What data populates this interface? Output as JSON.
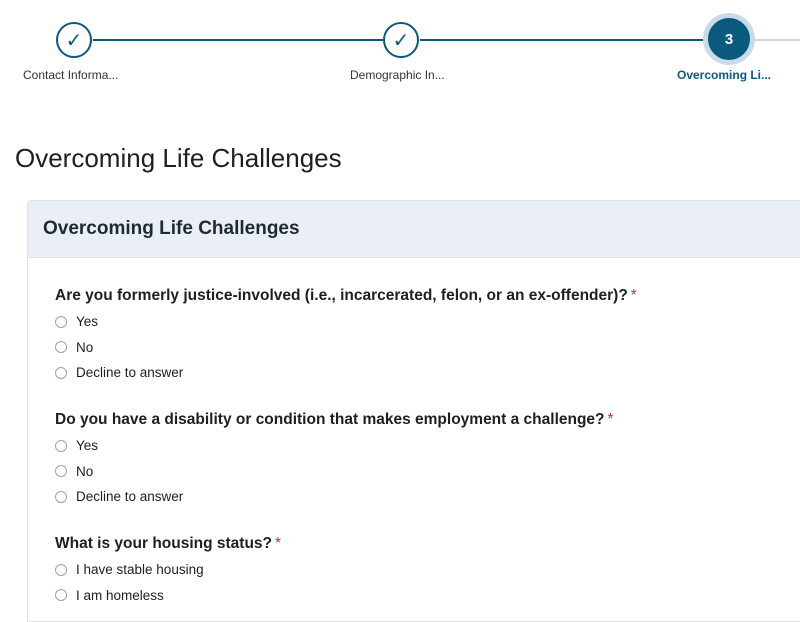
{
  "stepper": {
    "steps": [
      {
        "label": "Contact Informa...",
        "state": "done",
        "icon": "check-icon"
      },
      {
        "label": "Demographic In...",
        "state": "done",
        "icon": "check-icon"
      },
      {
        "label": "Overcoming Li...",
        "state": "current",
        "number": "3"
      }
    ]
  },
  "page": {
    "title": "Overcoming Life Challenges"
  },
  "card": {
    "header": "Overcoming Life Challenges",
    "questions": [
      {
        "label": "Are you formerly justice-involved (i.e., incarcerated, felon, or an ex-offender)?",
        "required": "*",
        "options": [
          "Yes",
          "No",
          "Decline to answer"
        ]
      },
      {
        "label": "Do you have a disability or condition that makes employment a challenge?",
        "required": "*",
        "options": [
          "Yes",
          "No",
          "Decline to answer"
        ]
      },
      {
        "label": "What is your housing status?",
        "required": "*",
        "options": [
          "I have stable housing",
          "I am homeless"
        ]
      }
    ]
  },
  "colors": {
    "accent": "#0a5a80",
    "required": "#c0392b",
    "card_header_bg": "#e9eff4"
  }
}
